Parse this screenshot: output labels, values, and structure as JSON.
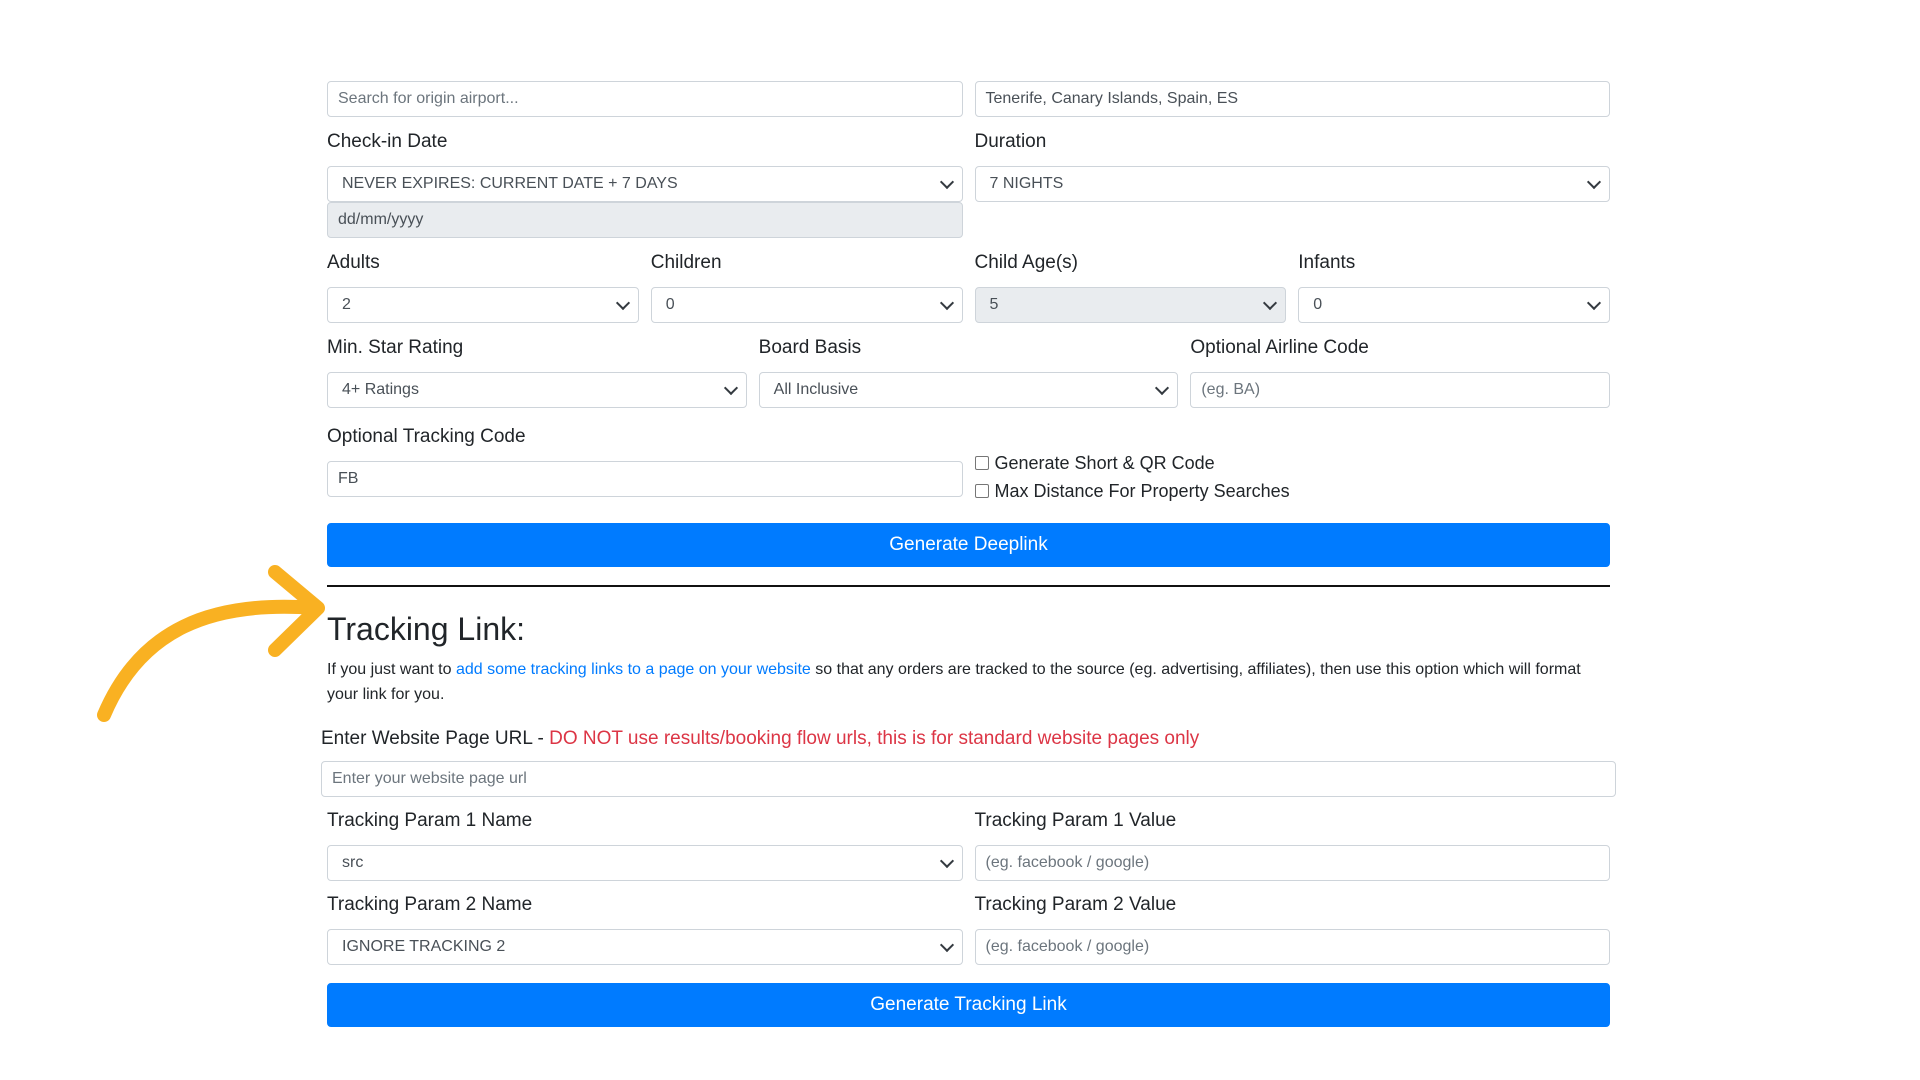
{
  "search": {
    "origin_placeholder": "Search for origin airport...",
    "destination_value": "Tenerife, Canary Islands, Spain, ES"
  },
  "checkin": {
    "label": "Check-in Date",
    "select_value": "NEVER EXPIRES: CURRENT DATE + 7 DAYS",
    "date_placeholder": "dd/mm/yyyy"
  },
  "duration": {
    "label": "Duration",
    "value": "7 NIGHTS"
  },
  "adults": {
    "label": "Adults",
    "value": "2"
  },
  "children": {
    "label": "Children",
    "value": "0"
  },
  "child_ages": {
    "label": "Child Age(s)",
    "value": "5"
  },
  "infants": {
    "label": "Infants",
    "value": "0"
  },
  "star_rating": {
    "label": "Min. Star Rating",
    "value": "4+ Ratings"
  },
  "board_basis": {
    "label": "Board Basis",
    "value": "All Inclusive"
  },
  "airline_code": {
    "label": "Optional Airline Code",
    "placeholder": "(eg. BA)"
  },
  "tracking_code": {
    "label": "Optional Tracking Code",
    "value": "FB"
  },
  "options": {
    "short_qr_label": "Generate Short & QR Code",
    "max_distance_label": "Max Distance For Property Searches"
  },
  "generate_deeplink_label": "Generate Deeplink",
  "tracking": {
    "heading": "Tracking Link:",
    "intro_before": "If you just want to ",
    "intro_link": "add some tracking links to a page on your website",
    "intro_after": " so that any orders are tracked to the source (eg. advertising, affiliates), then use this option which will format your link for you.",
    "url_label": "Enter Website Page URL - ",
    "url_warning": "DO NOT use results/booking flow urls, this is for standard website pages only",
    "url_placeholder": "Enter your website page url",
    "param1_name_label": "Tracking Param 1 Name",
    "param1_name_value": "src",
    "param1_value_label": "Tracking Param 1 Value",
    "param1_value_placeholder": "(eg. facebook / google)",
    "param2_name_label": "Tracking Param 2 Name",
    "param2_name_value": "IGNORE TRACKING 2",
    "param2_value_label": "Tracking Param 2 Value",
    "param2_value_placeholder": "(eg. facebook / google)",
    "generate_label": "Generate Tracking Link"
  },
  "colors": {
    "primary": "#007bff",
    "danger": "#dc3545",
    "arrow": "#f9b122"
  }
}
